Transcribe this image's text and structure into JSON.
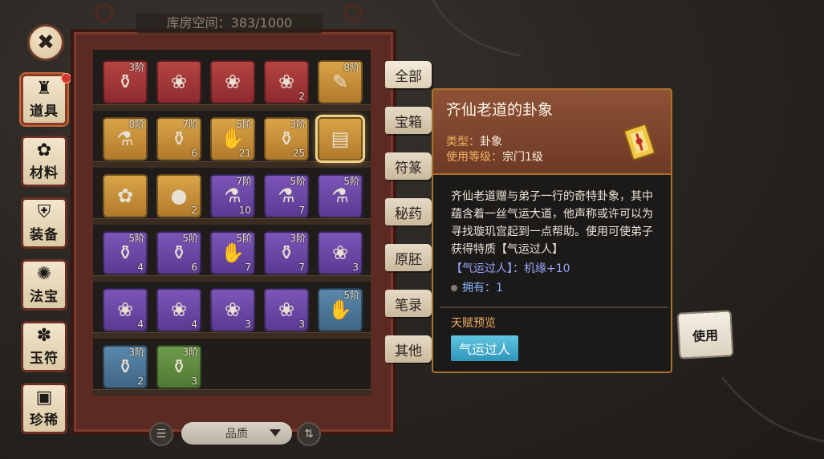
{
  "close_icon": "close-icon",
  "categories": [
    {
      "label": "道具",
      "icon": "bag-icon",
      "glyph": "♜",
      "active": true,
      "badge": true
    },
    {
      "label": "材料",
      "icon": "herb-icon",
      "glyph": "✿",
      "active": false,
      "badge": false
    },
    {
      "label": "装备",
      "icon": "helmet-icon",
      "glyph": "⛨",
      "active": false,
      "badge": false
    },
    {
      "label": "法宝",
      "icon": "swirl-icon",
      "glyph": "✺",
      "active": false,
      "badge": false
    },
    {
      "label": "玉符",
      "icon": "jade-icon",
      "glyph": "✽",
      "active": false,
      "badge": false
    },
    {
      "label": "珍稀",
      "icon": "chest-icon",
      "glyph": "▣",
      "active": false,
      "badge": false
    }
  ],
  "storage": {
    "label": "库房空间：383/1000"
  },
  "items": [
    {
      "tier": "3阶",
      "count": "",
      "color": "red",
      "art": "⚱",
      "row": 0,
      "col": 0
    },
    {
      "tier": "",
      "count": "",
      "color": "red",
      "art": "❀",
      "row": 0,
      "col": 1
    },
    {
      "tier": "",
      "count": "",
      "color": "red",
      "art": "❀",
      "row": 0,
      "col": 2
    },
    {
      "tier": "",
      "count": "2",
      "color": "red",
      "art": "❀",
      "row": 0,
      "col": 3
    },
    {
      "tier": "8阶",
      "count": "",
      "color": "gold",
      "art": "✎",
      "row": 0,
      "col": 4
    },
    {
      "tier": "8阶",
      "count": "",
      "color": "gold",
      "art": "⚗",
      "row": 1,
      "col": 0
    },
    {
      "tier": "7阶",
      "count": "6",
      "color": "gold",
      "art": "⚱",
      "row": 1,
      "col": 1
    },
    {
      "tier": "5阶",
      "count": "21",
      "color": "gold",
      "art": "✋",
      "row": 1,
      "col": 2
    },
    {
      "tier": "3阶",
      "count": "25",
      "color": "gold",
      "art": "⚱",
      "row": 1,
      "col": 3
    },
    {
      "tier": "",
      "count": "",
      "color": "gold",
      "art": "▤",
      "row": 1,
      "col": 4,
      "selected": true
    },
    {
      "tier": "",
      "count": "",
      "color": "gold",
      "art": "✿",
      "row": 2,
      "col": 0
    },
    {
      "tier": "",
      "count": "2",
      "color": "gold",
      "art": "●",
      "row": 2,
      "col": 1
    },
    {
      "tier": "7阶",
      "count": "10",
      "color": "purple",
      "art": "⚗",
      "row": 2,
      "col": 2
    },
    {
      "tier": "5阶",
      "count": "7",
      "color": "purple",
      "art": "⚗",
      "row": 2,
      "col": 3
    },
    {
      "tier": "5阶",
      "count": "",
      "color": "purple",
      "art": "⚗",
      "row": 2,
      "col": 4
    },
    {
      "tier": "5阶",
      "count": "4",
      "color": "purple",
      "art": "⚱",
      "row": 3,
      "col": 0
    },
    {
      "tier": "5阶",
      "count": "6",
      "color": "purple",
      "art": "⚱",
      "row": 3,
      "col": 1
    },
    {
      "tier": "5阶",
      "count": "7",
      "color": "purple",
      "art": "✋",
      "row": 3,
      "col": 2
    },
    {
      "tier": "3阶",
      "count": "7",
      "color": "purple",
      "art": "⚱",
      "row": 3,
      "col": 3
    },
    {
      "tier": "",
      "count": "3",
      "color": "purple",
      "art": "❀",
      "row": 3,
      "col": 4
    },
    {
      "tier": "",
      "count": "4",
      "color": "purple",
      "art": "❀",
      "row": 4,
      "col": 0
    },
    {
      "tier": "",
      "count": "4",
      "color": "purple",
      "art": "❀",
      "row": 4,
      "col": 1
    },
    {
      "tier": "",
      "count": "3",
      "color": "purple",
      "art": "❀",
      "row": 4,
      "col": 2
    },
    {
      "tier": "",
      "count": "3",
      "color": "purple",
      "art": "❀",
      "row": 4,
      "col": 3
    },
    {
      "tier": "5阶",
      "count": "",
      "color": "blue",
      "art": "✋",
      "row": 4,
      "col": 4
    },
    {
      "tier": "3阶",
      "count": "2",
      "color": "blue",
      "art": "⚱",
      "row": 5,
      "col": 0
    },
    {
      "tier": "3阶",
      "count": "3",
      "color": "green",
      "art": "⚱",
      "row": 5,
      "col": 1
    }
  ],
  "sort": {
    "quality_label": "品质",
    "filter_icon": "list-filter-icon",
    "order_icon": "sort-order-icon"
  },
  "tabs": [
    {
      "label": "全部",
      "active": true
    },
    {
      "label": "宝箱",
      "active": false
    },
    {
      "label": "符篆",
      "active": false
    },
    {
      "label": "秘药",
      "active": false
    },
    {
      "label": "原胚",
      "active": false
    },
    {
      "label": "笔录",
      "active": false
    },
    {
      "label": "其他",
      "active": false
    }
  ],
  "detail": {
    "title": "齐仙老道的卦象",
    "type_label": "类型：",
    "type_value": "卦象",
    "level_label": "使用等级：",
    "level_value": "宗门1级",
    "description": "齐仙老道赠与弟子一行的奇特卦象，其中蕴含着一丝气运大道，他声称或许可以为寻找璇玑宫起到一点帮助。使用可使弟子获得特质【气运过人】",
    "effect": "【气运过人】：机缘+10",
    "owned": "拥有：1",
    "talent_header": "天赋预览",
    "talent_button": "气运过人"
  },
  "use_button": "使用"
}
